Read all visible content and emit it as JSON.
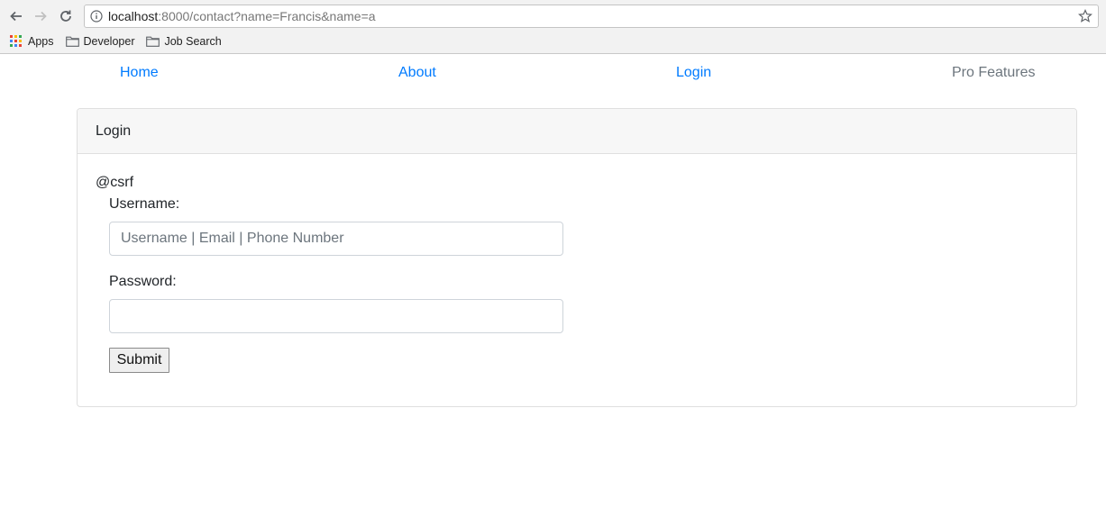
{
  "browser": {
    "url_host": "localhost",
    "url_rest": ":8000/contact?name=Francis&name=a",
    "bookmarks": [
      "Apps",
      "Developer",
      "Job Search"
    ]
  },
  "nav": {
    "home": "Home",
    "about": "About",
    "login": "Login",
    "pro": "Pro Features"
  },
  "card": {
    "title": "Login",
    "csrf": "@csrf",
    "username_label": "Username:",
    "username_placeholder": "Username | Email | Phone Number",
    "password_label": "Password:",
    "password_value": "",
    "submit_label": "Submit"
  },
  "colors": {
    "link": "#007bff",
    "muted_link": "#6c757d"
  }
}
